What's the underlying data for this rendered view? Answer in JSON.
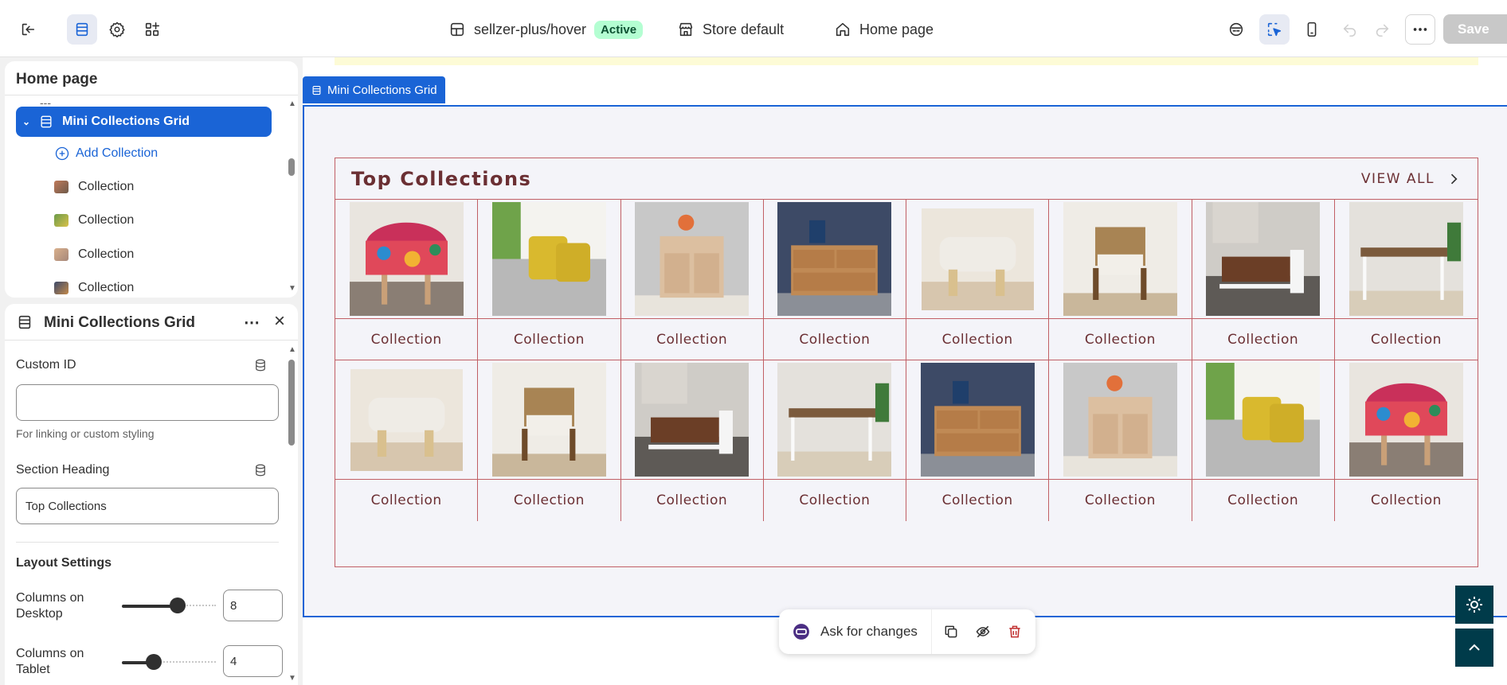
{
  "topbar": {
    "theme_name": "sellzer-plus/hover",
    "status": "Active",
    "store": "Store default",
    "page": "Home page",
    "save_label": "Save"
  },
  "tree": {
    "title": "Home page",
    "selected_section": "Mini Collections Grid",
    "add_label": "Add Collection",
    "items": [
      "Collection",
      "Collection",
      "Collection",
      "Collection"
    ]
  },
  "settings": {
    "title": "Mini Collections Grid",
    "custom_id_label": "Custom ID",
    "custom_id_value": "",
    "custom_id_help": "For linking or custom styling",
    "heading_label": "Section Heading",
    "heading_value": "Top Collections",
    "layout_heading": "Layout Settings",
    "desktop_label_1": "Columns on",
    "desktop_label_2": "Desktop",
    "desktop_value": "8",
    "desktop_level": 0.67,
    "tablet_label_1": "Columns on",
    "tablet_label_2": "Tablet",
    "tablet_value": "4",
    "tablet_level": 0.33
  },
  "preview": {
    "section_tag": "Mini Collections Grid",
    "heading": "Top Collections",
    "view_all": "VIEW ALL",
    "row1": [
      "Collection",
      "Collection",
      "Collection",
      "Collection",
      "Collection",
      "Collection",
      "Collection",
      "Collection"
    ],
    "row2": [
      "Collection",
      "Collection",
      "Collection",
      "Collection",
      "Collection",
      "Collection",
      "Collection",
      "Collection"
    ],
    "row1_images": [
      "ottoman-icon",
      "sofa-pillow-icon",
      "cabinet-icon",
      "dresser-icon",
      "footstool-icon",
      "armchair-icon",
      "coffee-table-icon",
      "desk-icon"
    ],
    "row2_images": [
      "footstool-icon",
      "armchair-icon",
      "coffee-table-icon",
      "desk-icon",
      "dresser-icon",
      "cabinet-icon",
      "sofa-pillow-icon",
      "ottoman-icon"
    ]
  },
  "ask_bar": {
    "label": "Ask for changes"
  },
  "colors": {
    "accent": "#1a64d6",
    "grid_border": "#c15f65",
    "grid_text": "#6b2f33",
    "badge_bg": "#b4fed2"
  }
}
